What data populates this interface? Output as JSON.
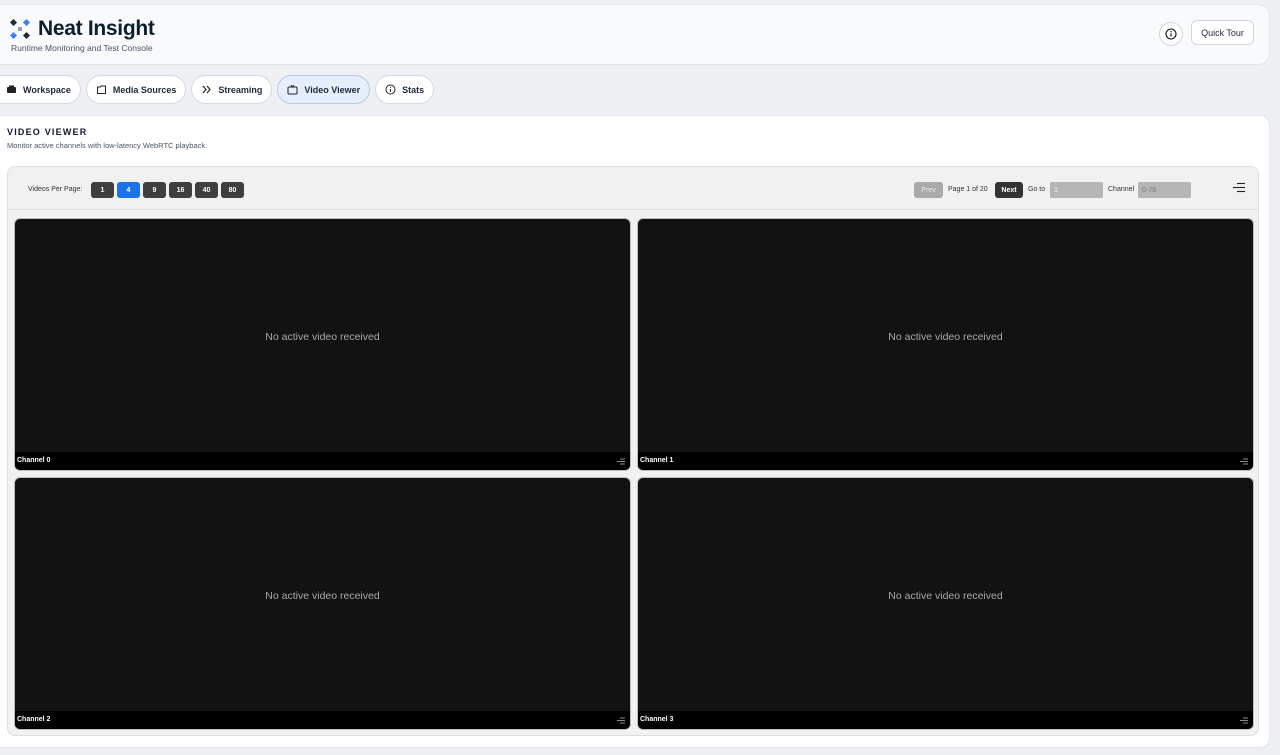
{
  "header": {
    "app_title": "Neat Insight",
    "subtitle": "Runtime Monitoring and Test Console",
    "quick_tour_label": "Quick Tour"
  },
  "tabs": [
    {
      "label": "Workspace",
      "icon": "workspace-icon",
      "active": false
    },
    {
      "label": "Media Sources",
      "icon": "folder-icon",
      "active": false
    },
    {
      "label": "Streaming",
      "icon": "double-chevron-right-icon",
      "active": false
    },
    {
      "label": "Video Viewer",
      "icon": "tv-icon",
      "active": true
    },
    {
      "label": "Stats",
      "icon": "info-circle-icon",
      "active": false
    }
  ],
  "viewer": {
    "section_title": "VIDEO VIEWER",
    "section_desc": "Monitor active channels with low-latency WebRTC playback.",
    "videos_per_page_label": "Videos Per Page:",
    "videos_per_page_options": [
      "1",
      "4",
      "9",
      "16",
      "40",
      "80"
    ],
    "videos_per_page_selected": "4",
    "prev_label": "Prev",
    "page_info": "Page 1 of 20",
    "next_label": "Next",
    "goto_label": "Go to",
    "goto_value": "1",
    "channel_label": "Channel",
    "channel_placeholder": "0-79"
  },
  "channels": [
    {
      "name": "Channel 0",
      "message": "No active video received"
    },
    {
      "name": "Channel 1",
      "message": "No active video received"
    },
    {
      "name": "Channel 2",
      "message": "No active video received"
    },
    {
      "name": "Channel 3",
      "message": "No active video received"
    }
  ],
  "colors": {
    "accent": "#1a73e8",
    "tile_bg": "#121212",
    "active_tab_bg": "#e7eefb"
  }
}
